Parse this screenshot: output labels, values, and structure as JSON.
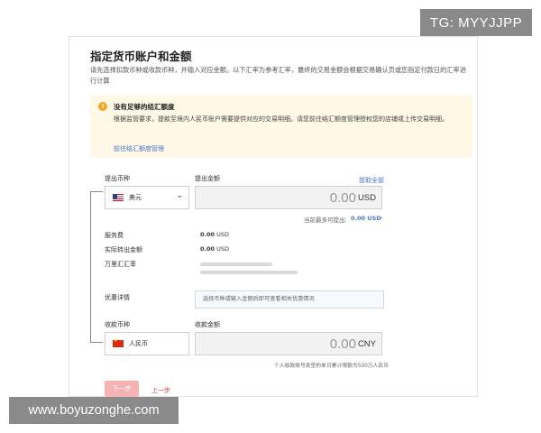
{
  "overlay": {
    "tg_badge": "TG: MYYJJPP",
    "site_badge": "www.boyuzonghe.com"
  },
  "page": {
    "title": "指定货币账户和金额",
    "description": "请先选择扣款币种或收款币种，并输入对应金额。以下汇率为参考汇率，最终的交易金额会根据交易确认页或您指定付款日的汇率进行计算"
  },
  "notice": {
    "icon": "warning-icon",
    "title": "没有足够的结汇额度",
    "body": "根据监管要求，提款至境内人民币账户需要提供对应的交易明细。请您前往结汇额度管理授权您的店铺或上传交易明细。",
    "link": "前往结汇额度管理"
  },
  "withdraw": {
    "currency_label": "提出币种",
    "amount_label": "提出金额",
    "withdraw_all": "提取全部",
    "currency": "美元",
    "amount": "0.00",
    "amount_currency": "USD",
    "available_label": "当前最多可提出:",
    "available_value": "0.00 USD"
  },
  "fees": {
    "service_fee_label": "服务费",
    "service_fee_value": "0.00",
    "service_fee_cur": "USD",
    "actual_label": "实际转出金额",
    "actual_value": "0.00",
    "actual_cur": "USD",
    "rate_label": "万里汇汇率"
  },
  "promo": {
    "label": "优惠详情",
    "placeholder": "选择币种或输入金额后即可查看相关优惠情况"
  },
  "receive": {
    "currency_label": "收款币种",
    "amount_label": "收款金额",
    "currency": "人民币",
    "amount": "0.00",
    "amount_currency": "CNY",
    "limit_note": "个人收款账号类型的单日累计限额为500万人民币"
  },
  "actions": {
    "next": "下一步",
    "prev": "上一步"
  },
  "colors": {
    "link": "#4a74c9",
    "notice_bg": "#fff8e6",
    "next_button": "#f5b3b3",
    "prev_link": "#d23c3c"
  }
}
